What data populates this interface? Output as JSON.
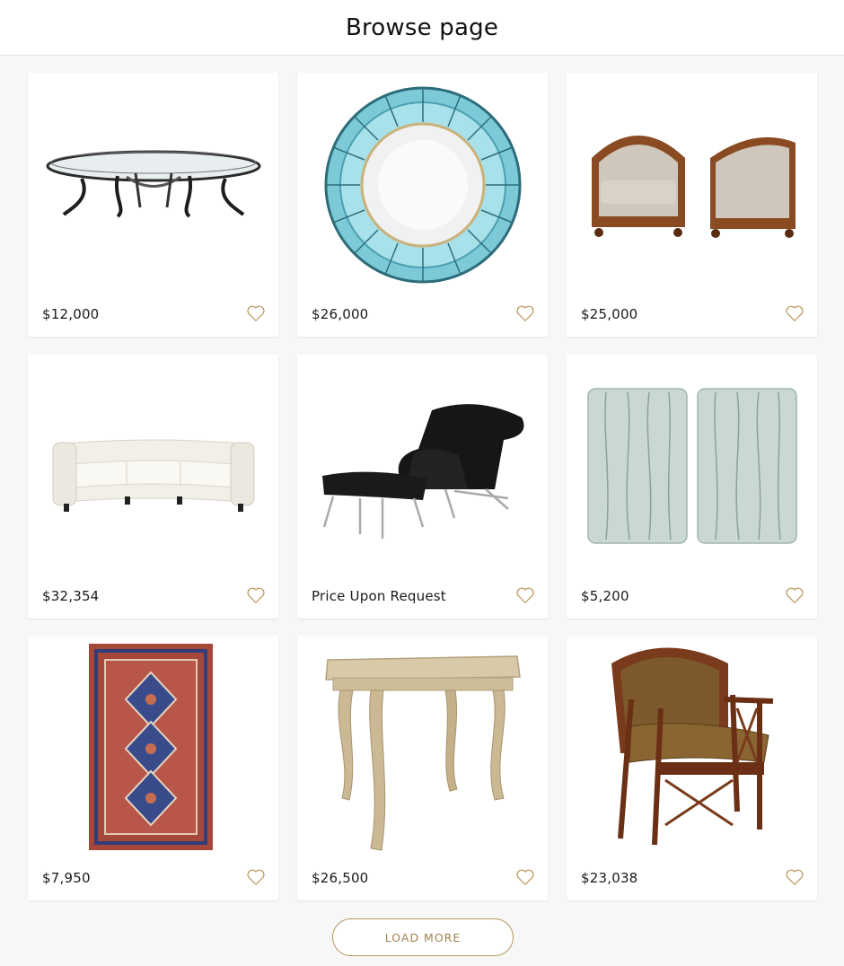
{
  "header": {
    "title": "Browse page"
  },
  "accent_color": "#b9975b",
  "items": [
    {
      "name": "glass coffee table",
      "price": "$12,000"
    },
    {
      "name": "blue glass mirror",
      "price": "$26,000"
    },
    {
      "name": "pair of armchairs",
      "price": "$25,000"
    },
    {
      "name": "curved white sofa",
      "price": "$32,354"
    },
    {
      "name": "black lounge chair and ottoman",
      "price": "Price Upon Request"
    },
    {
      "name": "pair of glass sconces",
      "price": "$5,200"
    },
    {
      "name": "red rug",
      "price": "$7,950"
    },
    {
      "name": "carved side table",
      "price": "$26,500"
    },
    {
      "name": "wood armchair",
      "price": "$23,038"
    }
  ],
  "actions": {
    "load_more_label": "LOAD MORE"
  },
  "icons": {
    "favorite": "heart-outline-icon"
  }
}
